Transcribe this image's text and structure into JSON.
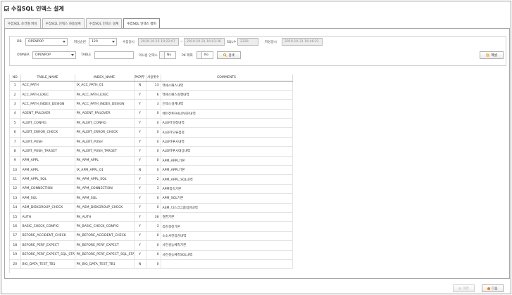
{
  "window": {
    "title": "수집SQL 인덱스 설계"
  },
  "tabs": [
    {
      "label": "수집SQL 조건절 파싱"
    },
    {
      "label": "수집SQL 인덱스 자동설계"
    },
    {
      "label": "수집SQL 인덱스 설계"
    },
    {
      "label": "수집SQL 인덱스 정비"
    }
  ],
  "filters": {
    "db_label": "DB",
    "db_value": "OPENPOP",
    "collect_period_label": "파싱순번",
    "collect_period_value": "120",
    "collect_date_label": "수집일시",
    "collect_date_from": "2019-10-15 19:22:07",
    "collect_date_sep": "~",
    "collect_date_to": "2019-10-31 16:03:36",
    "sql_count_label": "SQL수",
    "sql_count_value": "2320",
    "parse_date_label": "파싱일시",
    "parse_date_value": "2019-10-31 16:46:21",
    "owner_label": "OWNER",
    "owner_value": "OPENPOP",
    "table_label": "TABLE",
    "table_value": "",
    "unused_index_label": "미사용 인덱스",
    "unused_index_value": "No",
    "pk_only_label": "PK 제외",
    "pk_only_value": "No",
    "search_label": "검색",
    "excel_label": "엑셀"
  },
  "grid": {
    "columns": [
      "NO",
      "TABLE_NAME",
      "INDEX_NAME",
      "PK여부",
      "사용횟수",
      "COMMENTS"
    ],
    "rows": [
      [
        "1",
        "ACC_PATH",
        "IX_ACC_PATH_01",
        "N",
        "13",
        "액세스패스내역"
      ],
      [
        "2",
        "ACC_PATH_EXEC",
        "PK_ACC_PATH_EXEC",
        "Y",
        "6",
        "액세스패스실행내역"
      ],
      [
        "3",
        "ACC_PATH_INDEX_DESIGN",
        "PK_ACC_PATH_INDEX_DESIGN",
        "Y",
        "3",
        "인덱스설계내역"
      ],
      [
        "4",
        "AGENT_FAILOVER",
        "PK_AGENT_FAILOVER",
        "Y",
        "0",
        "에이전트FAILOVER내역"
      ],
      [
        "5",
        "ALERT_CONFIG",
        "PK_ALERT_CONFIG",
        "Y",
        "0",
        "ALERT설정내역"
      ],
      [
        "6",
        "ALERT_ERROR_CHECK",
        "PK_ALERT_ERROR_CHECK",
        "Y",
        "0",
        "ALERT오류점검"
      ],
      [
        "7",
        "ALERT_PUSH",
        "PK_ALERT_PUSH",
        "Y",
        "0",
        "ALERT푸시내역"
      ],
      [
        "8",
        "ALERT_PUSH_TARGET",
        "PK_ALERT_PUSH_TARGET",
        "Y",
        "0",
        "ALERT푸시대상내역"
      ],
      [
        "9",
        "APM_APPL",
        "PK_APM_APPL",
        "Y",
        "0",
        "APM_APPL기본"
      ],
      [
        "10",
        "APM_APPL",
        "IX_APM_APPL_01",
        "N",
        "0",
        "APM_APPL기본"
      ],
      [
        "11",
        "APM_APPL_SQL",
        "PK_APM_APPL_SQL",
        "Y",
        "2",
        "APM_APPL_SQL내역"
      ],
      [
        "12",
        "APM_CONNECTION",
        "PK_APM_CONNECTION",
        "Y",
        "3",
        "APM접속기본"
      ],
      [
        "13",
        "APM_SQL",
        "PK_APM_SQL",
        "Y",
        "0",
        "APM_SQL기본"
      ],
      [
        "14",
        "ASM_DISKGROUP_CHECK",
        "PK_ASM_DISKGROUP_CHECK",
        "Y",
        "0",
        "ASM_디스크그룹점검내역"
      ],
      [
        "15",
        "AUTH",
        "PK_AUTH",
        "Y",
        "36",
        "권한기본"
      ],
      [
        "16",
        "BASIC_CHECK_CONFIG",
        "PK_BASIC_CHECK_CONFIG",
        "Y",
        "3",
        "점검설정기본"
      ],
      [
        "17",
        "BEFORE_ACCIDENT_CHECK",
        "PK_BEFORE_ACCIDENT_CHECK",
        "Y",
        "0",
        "소소사전점검내역"
      ],
      [
        "18",
        "BEFORE_PERF_EXPECT",
        "PK_BEFORE_PERF_EXPECT",
        "Y",
        "0",
        "사전성능예측기본"
      ],
      [
        "19",
        "BEFORE_PERF_EXPECT_SQL_STAT",
        "PK_BEFORE_PERF_EXPECT_SQL_STAT",
        "Y",
        "0",
        "사전성능예측SQL내역"
      ],
      [
        "20",
        "BIG_DATA_TEST_TB1",
        "PK_BIG_DATA_TEST_TB1",
        "N",
        "0",
        ""
      ]
    ]
  },
  "footer": {
    "prev_label": "이전",
    "next_label": "다음"
  },
  "colors": {
    "accent": "#f0a020",
    "border": "#a8a8a8",
    "next": "#e67e22"
  }
}
